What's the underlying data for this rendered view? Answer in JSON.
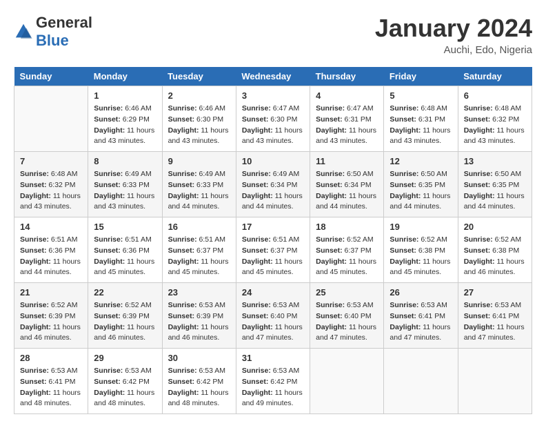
{
  "header": {
    "logo_general": "General",
    "logo_blue": "Blue",
    "month_year": "January 2024",
    "location": "Auchi, Edo, Nigeria"
  },
  "days_of_week": [
    "Sunday",
    "Monday",
    "Tuesday",
    "Wednesday",
    "Thursday",
    "Friday",
    "Saturday"
  ],
  "weeks": [
    [
      {
        "day": "",
        "sunrise": "",
        "sunset": "",
        "daylight": ""
      },
      {
        "day": "1",
        "sunrise": "6:46 AM",
        "sunset": "6:29 PM",
        "daylight": "11 hours and 43 minutes."
      },
      {
        "day": "2",
        "sunrise": "6:46 AM",
        "sunset": "6:30 PM",
        "daylight": "11 hours and 43 minutes."
      },
      {
        "day": "3",
        "sunrise": "6:47 AM",
        "sunset": "6:30 PM",
        "daylight": "11 hours and 43 minutes."
      },
      {
        "day": "4",
        "sunrise": "6:47 AM",
        "sunset": "6:31 PM",
        "daylight": "11 hours and 43 minutes."
      },
      {
        "day": "5",
        "sunrise": "6:48 AM",
        "sunset": "6:31 PM",
        "daylight": "11 hours and 43 minutes."
      },
      {
        "day": "6",
        "sunrise": "6:48 AM",
        "sunset": "6:32 PM",
        "daylight": "11 hours and 43 minutes."
      }
    ],
    [
      {
        "day": "7",
        "sunrise": "6:48 AM",
        "sunset": "6:32 PM",
        "daylight": "11 hours and 43 minutes."
      },
      {
        "day": "8",
        "sunrise": "6:49 AM",
        "sunset": "6:33 PM",
        "daylight": "11 hours and 43 minutes."
      },
      {
        "day": "9",
        "sunrise": "6:49 AM",
        "sunset": "6:33 PM",
        "daylight": "11 hours and 44 minutes."
      },
      {
        "day": "10",
        "sunrise": "6:49 AM",
        "sunset": "6:34 PM",
        "daylight": "11 hours and 44 minutes."
      },
      {
        "day": "11",
        "sunrise": "6:50 AM",
        "sunset": "6:34 PM",
        "daylight": "11 hours and 44 minutes."
      },
      {
        "day": "12",
        "sunrise": "6:50 AM",
        "sunset": "6:35 PM",
        "daylight": "11 hours and 44 minutes."
      },
      {
        "day": "13",
        "sunrise": "6:50 AM",
        "sunset": "6:35 PM",
        "daylight": "11 hours and 44 minutes."
      }
    ],
    [
      {
        "day": "14",
        "sunrise": "6:51 AM",
        "sunset": "6:36 PM",
        "daylight": "11 hours and 44 minutes."
      },
      {
        "day": "15",
        "sunrise": "6:51 AM",
        "sunset": "6:36 PM",
        "daylight": "11 hours and 45 minutes."
      },
      {
        "day": "16",
        "sunrise": "6:51 AM",
        "sunset": "6:37 PM",
        "daylight": "11 hours and 45 minutes."
      },
      {
        "day": "17",
        "sunrise": "6:51 AM",
        "sunset": "6:37 PM",
        "daylight": "11 hours and 45 minutes."
      },
      {
        "day": "18",
        "sunrise": "6:52 AM",
        "sunset": "6:37 PM",
        "daylight": "11 hours and 45 minutes."
      },
      {
        "day": "19",
        "sunrise": "6:52 AM",
        "sunset": "6:38 PM",
        "daylight": "11 hours and 45 minutes."
      },
      {
        "day": "20",
        "sunrise": "6:52 AM",
        "sunset": "6:38 PM",
        "daylight": "11 hours and 46 minutes."
      }
    ],
    [
      {
        "day": "21",
        "sunrise": "6:52 AM",
        "sunset": "6:39 PM",
        "daylight": "11 hours and 46 minutes."
      },
      {
        "day": "22",
        "sunrise": "6:52 AM",
        "sunset": "6:39 PM",
        "daylight": "11 hours and 46 minutes."
      },
      {
        "day": "23",
        "sunrise": "6:53 AM",
        "sunset": "6:39 PM",
        "daylight": "11 hours and 46 minutes."
      },
      {
        "day": "24",
        "sunrise": "6:53 AM",
        "sunset": "6:40 PM",
        "daylight": "11 hours and 47 minutes."
      },
      {
        "day": "25",
        "sunrise": "6:53 AM",
        "sunset": "6:40 PM",
        "daylight": "11 hours and 47 minutes."
      },
      {
        "day": "26",
        "sunrise": "6:53 AM",
        "sunset": "6:41 PM",
        "daylight": "11 hours and 47 minutes."
      },
      {
        "day": "27",
        "sunrise": "6:53 AM",
        "sunset": "6:41 PM",
        "daylight": "11 hours and 47 minutes."
      }
    ],
    [
      {
        "day": "28",
        "sunrise": "6:53 AM",
        "sunset": "6:41 PM",
        "daylight": "11 hours and 48 minutes."
      },
      {
        "day": "29",
        "sunrise": "6:53 AM",
        "sunset": "6:42 PM",
        "daylight": "11 hours and 48 minutes."
      },
      {
        "day": "30",
        "sunrise": "6:53 AM",
        "sunset": "6:42 PM",
        "daylight": "11 hours and 48 minutes."
      },
      {
        "day": "31",
        "sunrise": "6:53 AM",
        "sunset": "6:42 PM",
        "daylight": "11 hours and 49 minutes."
      },
      {
        "day": "",
        "sunrise": "",
        "sunset": "",
        "daylight": ""
      },
      {
        "day": "",
        "sunrise": "",
        "sunset": "",
        "daylight": ""
      },
      {
        "day": "",
        "sunrise": "",
        "sunset": "",
        "daylight": ""
      }
    ]
  ],
  "labels": {
    "sunrise": "Sunrise:",
    "sunset": "Sunset:",
    "daylight": "Daylight:"
  },
  "accent_color": "#2a6db5"
}
